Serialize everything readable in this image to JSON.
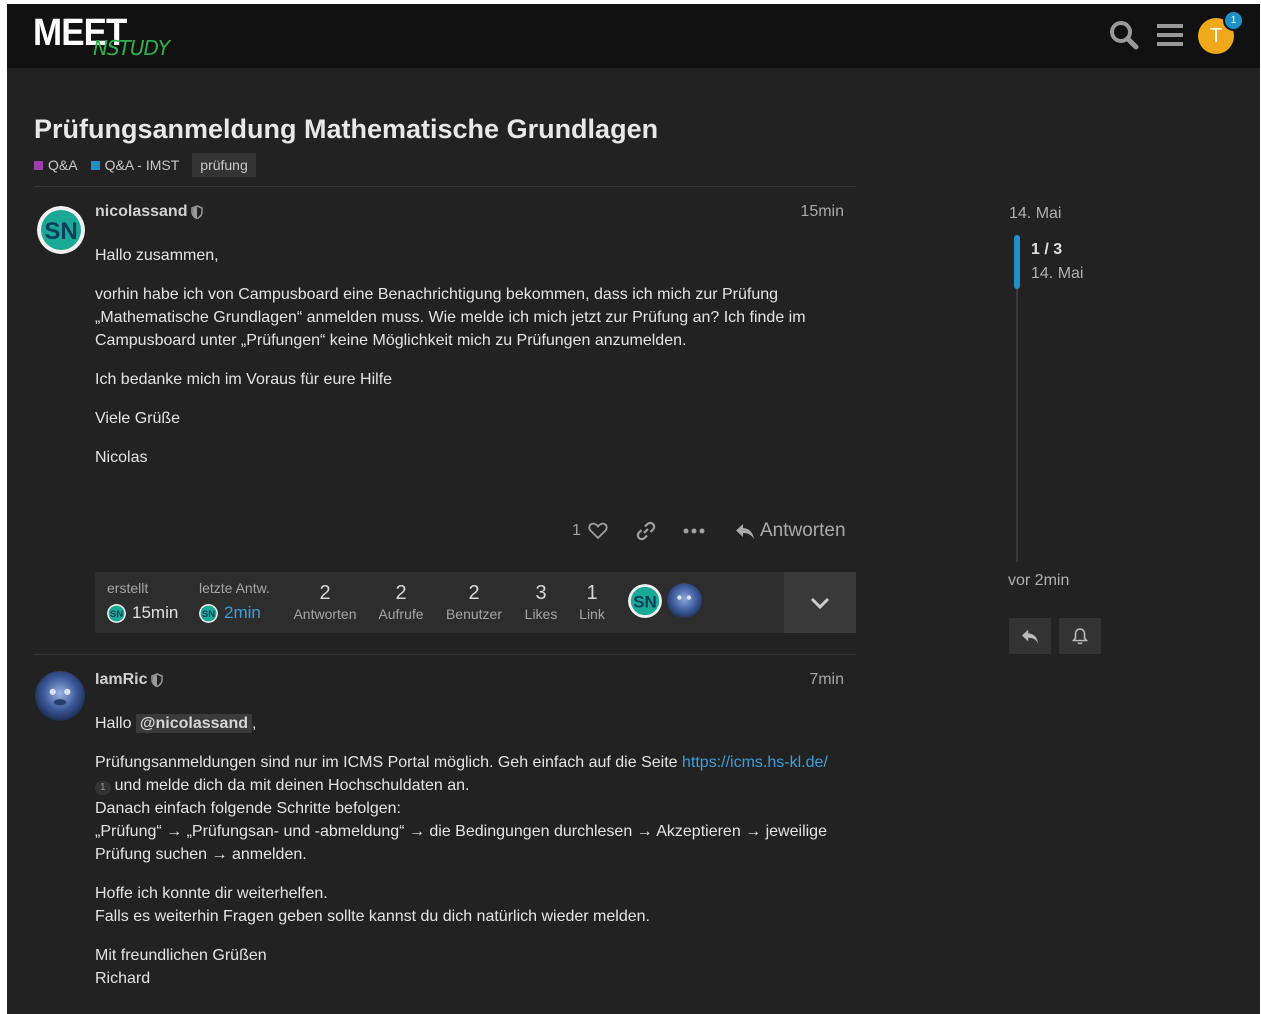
{
  "header": {
    "logo_main": "MEET",
    "logo_sub": "NSTUDY",
    "user_initial": "T",
    "notification_count": "1",
    "icons": [
      "search-icon",
      "menu-icon"
    ]
  },
  "topic": {
    "title": "Prüfungsanmeldung Mathematische Grundlagen",
    "category": "Q&A",
    "subcategory": "Q&A - IMST",
    "tag": "prüfung",
    "colors": {
      "category": "#9b3fa8",
      "subcategory": "#1e90c8",
      "accent": "#1e90c8",
      "link": "#3a9fdc",
      "avatar_user": "#f0a91b"
    }
  },
  "posts": [
    {
      "username": "nicolassand",
      "time": "15min",
      "avatar_text": "SN",
      "paragraphs": [
        "Hallo zusammen,",
        "vorhin habe ich von Campusboard eine Benachrichtigung bekommen, dass ich mich zur Prüfung „Mathematische Grundlagen“ anmelden muss. Wie melde ich mich jetzt zur Prüfung an? Ich finde im Campusboard unter „Prüfungen“ keine Möglichkeit mich zu Prüfungen anzumelden.",
        "Ich bedanke mich im Voraus für eure Hilfe",
        "Viele Grüße",
        "Nicolas"
      ],
      "likes": "1",
      "reply_label": "Antworten"
    },
    {
      "username": "IamRic",
      "time": "7min",
      "greeting": "Hallo",
      "mention": "@nicolassand",
      "mention_suffix": ",",
      "line1_pre": "Prüfungsanmeldungen sind nur im ICMS Portal möglich. Geh einfach auf die Seite",
      "link_text": "https://icms.hs-kl.de/",
      "link_clicks": "1",
      "line1_post": "und melde dich da mit deinen Hochschuldaten an.",
      "line2": "Danach einfach folgende Schritte befolgen:",
      "line3": "„Prüfung“ → „Prüfungsan- und -abmeldung“ → die Bedingungen durchlesen → Akzeptieren → jeweilige Prüfung suchen → anmelden.",
      "line4": "Hoffe ich konnte dir weiterhelfen.",
      "line5": "Falls es weiterhin Fragen geben sollte kannst du dich natürlich wieder melden.",
      "line6": "Mit freundlichen Grüßen",
      "line7": "Richard"
    }
  ],
  "stats": {
    "created_label": "erstellt",
    "created_time": "15min",
    "last_label": "letzte Antw.",
    "last_time": "2min",
    "items": [
      {
        "num": "2",
        "label": "Antworten"
      },
      {
        "num": "2",
        "label": "Aufrufe"
      },
      {
        "num": "2",
        "label": "Benutzer"
      },
      {
        "num": "3",
        "label": "Likes"
      },
      {
        "num": "1",
        "label": "Link"
      }
    ]
  },
  "timeline": {
    "start_date": "14. Mai",
    "position": "1 / 3",
    "position_date": "14. Mai",
    "end_label": "vor 2min"
  }
}
